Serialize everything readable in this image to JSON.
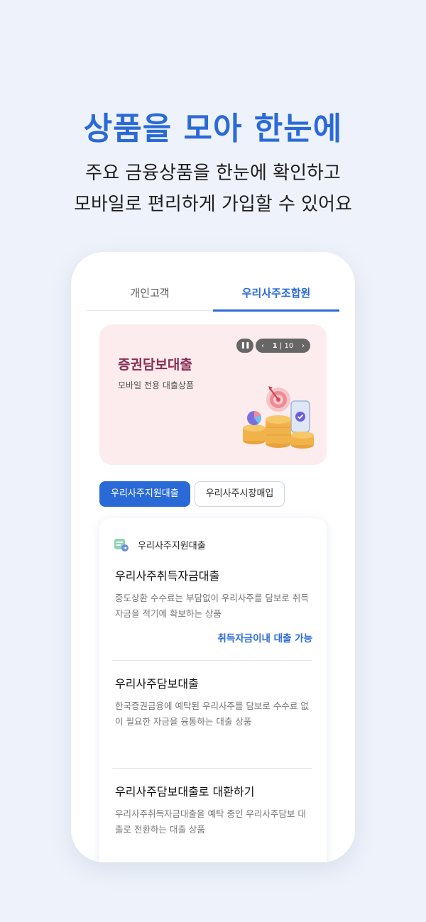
{
  "hero": {
    "title": "상품을 모아 한눈에",
    "subtitle_line1": "주요 금융상품을 한눈에 확인하고",
    "subtitle_line2": "모바일로 편리하게 가입할 수 있어요"
  },
  "tabs": [
    {
      "label": "개인고객",
      "active": false
    },
    {
      "label": "우리사주조합원",
      "active": true
    }
  ],
  "banner": {
    "title": "증권담보대출",
    "subtitle": "모바일 전용 대출상품",
    "pause_icon": "pause-icon",
    "pager": {
      "current": "1",
      "separator": "|",
      "total": "10"
    },
    "prev_icon": "chevron-left-icon",
    "next_icon": "chevron-right-icon",
    "illustration": "coins-target-phone-illustration"
  },
  "chips": [
    {
      "label": "우리사주지원대출",
      "active": true
    },
    {
      "label": "우리사주시장매입",
      "active": false
    }
  ],
  "card": {
    "header_icon": "loan-document-icon",
    "header_label": "우리사주지원대출",
    "items": [
      {
        "title": "우리사주취득자금대출",
        "desc": "중도상환 수수료는 부담없이 우리사주를 담보로 취득 자금을 적기에 확보하는 상품",
        "link": "취득자금이내 대출 가능"
      },
      {
        "title": "우리사주담보대출",
        "desc": "한국증권금융에 예탁된 우리사주를 담보로 수수료 없이 필요한 자금을 융통하는 대출 상품"
      },
      {
        "title": "우리사주담보대출로 대환하기",
        "desc": "우리사주취득자금대출을 예탁 중인 우리사주담보 대출로 전환하는 대출 상품"
      }
    ]
  },
  "colors": {
    "accent": "#2a6ad6",
    "banner_bg": "#fcecee",
    "banner_title": "#8a2e54",
    "page_bg": "#eef2fa"
  }
}
